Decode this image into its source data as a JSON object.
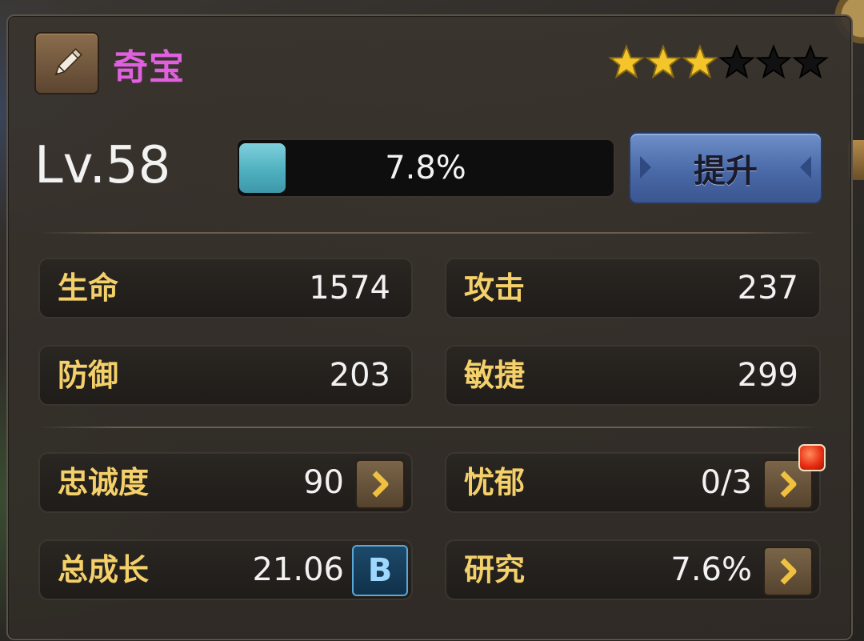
{
  "header": {
    "title": "奇宝",
    "stars_filled": 3,
    "stars_total": 6,
    "colors": {
      "title": "#e060e0",
      "star_filled": "#f3c52b",
      "star_empty": "#111111"
    }
  },
  "level": {
    "label": "Lv.58",
    "exp_percent_text": "7.8%",
    "exp_fraction": 0.078,
    "upgrade_label": "提升"
  },
  "stats": {
    "hp": {
      "label": "生命",
      "value": "1574"
    },
    "atk": {
      "label": "攻击",
      "value": "237"
    },
    "def": {
      "label": "防御",
      "value": "203"
    },
    "agi": {
      "label": "敏捷",
      "value": "299"
    }
  },
  "extras": {
    "loyalty": {
      "label": "忠诚度",
      "value": "90"
    },
    "melancholy": {
      "label": "忧郁",
      "value": "0/3"
    },
    "growth": {
      "label": "总成长",
      "value": "21.06",
      "grade": "B"
    },
    "research": {
      "label": "研究",
      "value": "7.6%"
    }
  },
  "icons": [
    "pencil-icon",
    "star-icon",
    "chevron-right-icon",
    "notification-dot"
  ]
}
